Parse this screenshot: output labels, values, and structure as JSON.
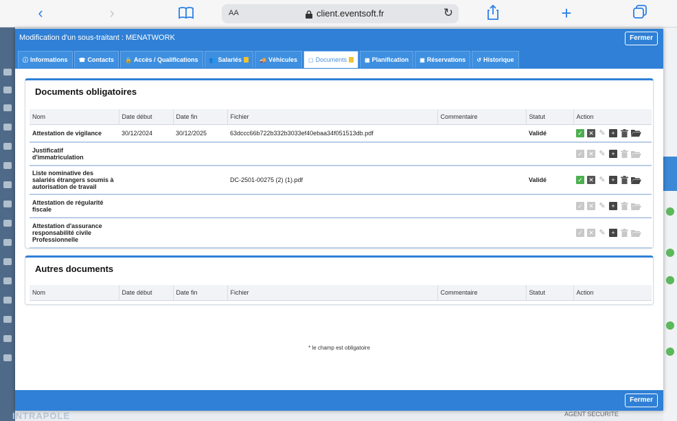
{
  "browser": {
    "text_size_label": "AA",
    "url": "client.eventsoft.fr",
    "icons": [
      "back-icon",
      "forward-icon",
      "bookmarks-icon",
      "lock-icon",
      "reload-icon",
      "share-icon",
      "new-tab-icon",
      "tabs-icon"
    ]
  },
  "modal": {
    "title": "Modification d'un sous-traitant : MENATWORK",
    "close_label": "Fermer",
    "footer_close_label": "Fermer",
    "accent_color": "#2f80d6"
  },
  "tabs": [
    {
      "label": "Informations",
      "icon": "info-icon"
    },
    {
      "label": "Contacts",
      "icon": "contacts-icon"
    },
    {
      "label": "Accès / Qualifications",
      "icon": "lock-icon"
    },
    {
      "label": "Salariés",
      "icon": "users-icon",
      "flag": true
    },
    {
      "label": "Véhicules",
      "icon": "vehicle-icon"
    },
    {
      "label": "Documents",
      "icon": "document-icon",
      "flag": true,
      "active": true
    },
    {
      "label": "Planification",
      "icon": "calendar-icon"
    },
    {
      "label": "Réservations",
      "icon": "calendar-check-icon"
    },
    {
      "label": "Historique",
      "icon": "history-icon"
    }
  ],
  "columns": [
    "Nom",
    "Date début",
    "Date fin",
    "Fichier",
    "Commentaire",
    "Statut",
    "Action"
  ],
  "mandatory": {
    "title": "Documents obligatoires",
    "rows": [
      {
        "nom": "Attestation de vigilance",
        "date_debut": "30/12/2024",
        "date_fin": "30/12/2025",
        "fichier": "63dccc66b722b332b3033ef40ebaa34f051513db.pdf",
        "commentaire": "",
        "statut": "Validé",
        "active": true
      },
      {
        "nom": "Justificatif d'immatriculation",
        "date_debut": "",
        "date_fin": "",
        "fichier": "",
        "commentaire": "",
        "statut": "",
        "active": false
      },
      {
        "nom": "Liste nominative des salariés étrangers soumis à autorisation de travail",
        "date_debut": "",
        "date_fin": "",
        "fichier": "DC-2501-00275 (2) (1).pdf",
        "commentaire": "",
        "statut": "Validé",
        "active": true
      },
      {
        "nom": "Attestation de régularité fiscale",
        "date_debut": "",
        "date_fin": "",
        "fichier": "",
        "commentaire": "",
        "statut": "",
        "active": false
      },
      {
        "nom": "Attestation d'assurance responsabilité civile Professionnelle",
        "date_debut": "",
        "date_fin": "",
        "fichier": "",
        "commentaire": "",
        "statut": "",
        "active": false
      }
    ]
  },
  "others": {
    "title": "Autres documents"
  },
  "required_note": "* le champ est obligatoire",
  "background": {
    "logo": "INTRAPOLE",
    "agent_label": "AGENT SECURITE"
  }
}
